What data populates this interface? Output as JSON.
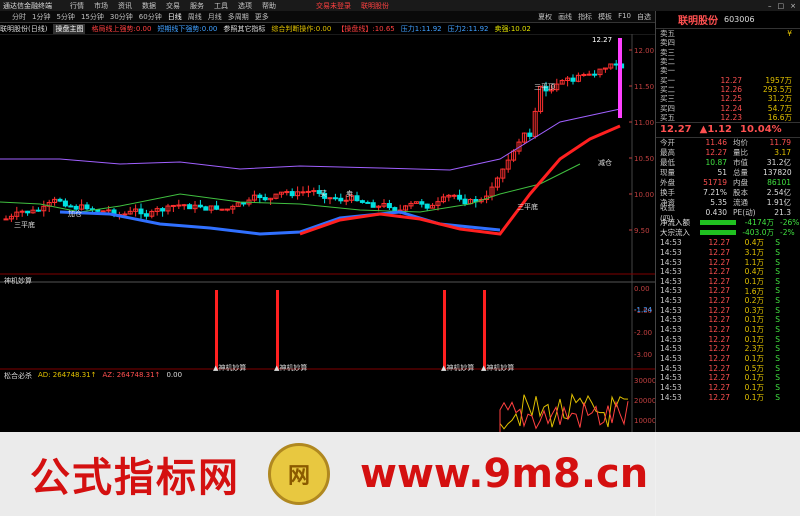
{
  "window": {
    "app": "通达信金融终端",
    "menus": [
      "行情",
      "市场",
      "资讯",
      "数据",
      "交易",
      "服务",
      "工具",
      "选项",
      "帮助"
    ],
    "alert": "交易未登录",
    "alert2": "联明股份",
    "controls": [
      "–",
      "□",
      "×"
    ]
  },
  "toolbar": {
    "periods": [
      "分时",
      "1分钟",
      "5分钟",
      "15分钟",
      "30分钟",
      "60分钟",
      "日线",
      "周线",
      "月线",
      "多周期",
      "更多"
    ],
    "active": "日线",
    "right": [
      "夏权",
      "画线",
      "指标",
      "模板",
      "F10",
      "自选"
    ]
  },
  "indicators": {
    "stock": "联明股份(日线)",
    "main": "操盘主图",
    "t1": "格局线上强势",
    "t1v": "0.00",
    "t2": "短期线下强势",
    "t2v": "0.00",
    "t3": "参照其它指标",
    "t4": "综合判断操作",
    "t4v": "0.00",
    "t5": "【操盘线】",
    "t5v": "10.65",
    "t6": "压力1",
    "t6v": "11.92",
    "t7": "压力2",
    "t7v": "11.92",
    "t8": "卖强",
    "t8v": "10.02"
  },
  "sub1": {
    "title": "神机妙算",
    "annot": "神机妙算",
    "yticks": [
      "0.00",
      "-1.00",
      "-2.00",
      "-3.00"
    ],
    "current": "-1.24"
  },
  "sub2": {
    "title": "松合必杀",
    "ad_label": "AD:",
    "ad_val": "264748.31↑",
    "az_label": "AZ:",
    "az_val": "264748.31↑",
    "other": "0.00",
    "yticks": [
      "30000",
      "20000",
      "10000"
    ]
  },
  "main_chart": {
    "price_tag": "12.27",
    "yticks": [
      "12.00",
      "11.50",
      "11.00",
      "10.50",
      "10.00",
      "9.50"
    ],
    "labels": [
      "三平底",
      "三平顶",
      "加仓",
      "买",
      "卖",
      "减仓",
      "三平底"
    ]
  },
  "stock": {
    "name": "联明股份",
    "code": "603006"
  },
  "orderbook": {
    "asks": [
      {
        "label": "卖五",
        "price": "",
        "vol": "¥"
      },
      {
        "label": "卖四",
        "price": "",
        "vol": ""
      },
      {
        "label": "卖三",
        "price": "",
        "vol": ""
      },
      {
        "label": "卖二",
        "price": "",
        "vol": ""
      },
      {
        "label": "卖一",
        "price": "",
        "vol": ""
      }
    ],
    "bids": [
      {
        "label": "买一",
        "price": "12.27",
        "vol": "1957万"
      },
      {
        "label": "买二",
        "price": "12.26",
        "vol": "293.5万"
      },
      {
        "label": "买三",
        "price": "12.25",
        "vol": "31.2万"
      },
      {
        "label": "买四",
        "price": "12.24",
        "vol": "54.7万"
      },
      {
        "label": "买五",
        "price": "12.23",
        "vol": "16.6万"
      }
    ]
  },
  "last": {
    "price": "12.27",
    "change": "▲1.12",
    "pct": "10.04%"
  },
  "stats": [
    {
      "k": "今开",
      "v": "11.46",
      "k2": "均价",
      "v2": "11.79",
      "c": "r",
      "c2": "r"
    },
    {
      "k": "最高",
      "v": "12.27",
      "k2": "量比",
      "v2": "3.17",
      "c": "r",
      "c2": "y"
    },
    {
      "k": "最低",
      "v": "10.87",
      "k2": "市值",
      "v2": "31.2亿",
      "c": "g",
      "c2": "w"
    },
    {
      "k": "现量",
      "v": "51",
      "k2": "总量",
      "v2": "137820",
      "c": "w",
      "c2": "w"
    },
    {
      "k": "外盘",
      "v": "51719",
      "k2": "内盘",
      "v2": "86101",
      "c": "r",
      "c2": "g"
    },
    {
      "k": "换手",
      "v": "7.21%",
      "k2": "股本",
      "v2": "2.54亿",
      "c": "w",
      "c2": "w"
    },
    {
      "k": "净资",
      "v": "5.35",
      "k2": "流通",
      "v2": "1.91亿",
      "c": "w",
      "c2": "w"
    },
    {
      "k": "收益(四)",
      "v": "0.430",
      "k2": "PE(动)",
      "v2": "21.3",
      "c": "w",
      "c2": "w"
    }
  ],
  "flows": [
    {
      "k": "净流入额",
      "v": "-4174万",
      "pct": "-26%",
      "color": "#20c020"
    },
    {
      "k": "大宗流入",
      "v": "-403.0万",
      "pct": "-2%",
      "color": "#20c020"
    }
  ],
  "ticks": [
    {
      "t": "14:53",
      "p": "12.27",
      "v": "0.4万",
      "s": "S"
    },
    {
      "t": "14:53",
      "p": "12.27",
      "v": "3.1万",
      "s": "S"
    },
    {
      "t": "14:53",
      "p": "12.27",
      "v": "1.1万",
      "s": "S"
    },
    {
      "t": "14:53",
      "p": "12.27",
      "v": "0.4万",
      "s": "S"
    },
    {
      "t": "14:53",
      "p": "12.27",
      "v": "0.1万",
      "s": "S"
    },
    {
      "t": "14:53",
      "p": "12.27",
      "v": "1.6万",
      "s": "S"
    },
    {
      "t": "14:53",
      "p": "12.27",
      "v": "0.2万",
      "s": "S"
    },
    {
      "t": "14:53",
      "p": "12.27",
      "v": "0.3万",
      "s": "S"
    },
    {
      "t": "14:53",
      "p": "12.27",
      "v": "0.1万",
      "s": "S"
    },
    {
      "t": "14:53",
      "p": "12.27",
      "v": "0.1万",
      "s": "S"
    },
    {
      "t": "14:53",
      "p": "12.27",
      "v": "0.1万",
      "s": "S"
    },
    {
      "t": "14:53",
      "p": "12.27",
      "v": "2.3万",
      "s": "S"
    },
    {
      "t": "14:53",
      "p": "12.27",
      "v": "0.1万",
      "s": "S"
    },
    {
      "t": "14:53",
      "p": "12.27",
      "v": "0.5万",
      "s": "S"
    },
    {
      "t": "14:53",
      "p": "12.27",
      "v": "0.1万",
      "s": "S"
    },
    {
      "t": "14:53",
      "p": "12.27",
      "v": "0.1万",
      "s": "S"
    },
    {
      "t": "14:53",
      "p": "12.27",
      "v": "0.1万",
      "s": "S"
    }
  ],
  "watermark": {
    "text": "公式指标网",
    "url": "www.9m8.cn",
    "logo": "网"
  }
}
